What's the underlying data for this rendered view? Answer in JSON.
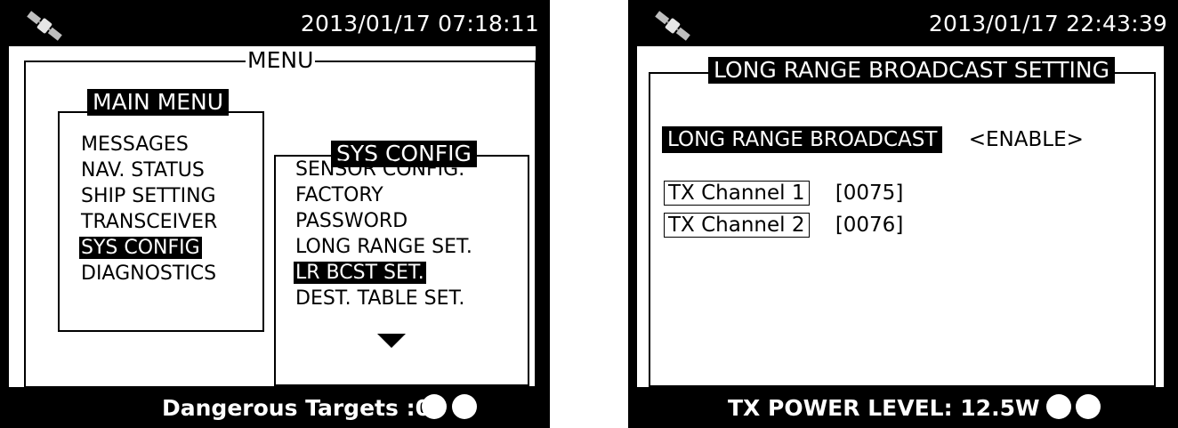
{
  "left_screen": {
    "datetime": "2013/01/17 07:18:11",
    "panel_title": "MENU",
    "main_menu": {
      "title": "MAIN MENU",
      "items": [
        "MESSAGES",
        "NAV. STATUS",
        "SHIP SETTING",
        "TRANSCEIVER",
        "SYS CONFIG",
        "DIAGNOSTICS"
      ],
      "selected_index": 4
    },
    "sys_config_menu": {
      "title": "SYS CONFIG",
      "items": [
        "SENSOR CONFIG.",
        "FACTORY",
        "PASSWORD",
        "LONG RANGE SET.",
        "LR BCST SET.",
        "DEST. TABLE SET."
      ],
      "selected_index": 4
    },
    "footer": "Dangerous Targets :0"
  },
  "right_screen": {
    "datetime": "2013/01/17 22:43:39",
    "panel_title": "LONG RANGE BROADCAST SETTING",
    "broadcast": {
      "label": "LONG RANGE BROADCAST",
      "value": "<ENABLE>"
    },
    "channels": [
      {
        "label": "TX Channel 1",
        "value": "[0075]"
      },
      {
        "label": "TX Channel 2",
        "value": "[0076]"
      }
    ],
    "footer": "TX POWER LEVEL: 12.5W"
  },
  "icons": {
    "status": "satellite-icon",
    "indicators": "status-indicator-dot",
    "scroll": "scroll-down-arrow-icon"
  },
  "colors": {
    "screen_bg": "#000000",
    "panel_bg": "#ffffff",
    "highlight_bg": "#000000",
    "highlight_fg": "#ffffff"
  }
}
